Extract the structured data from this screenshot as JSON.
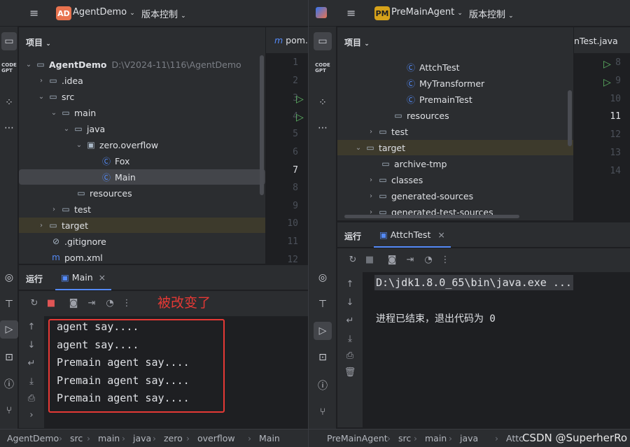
{
  "left": {
    "project_badge": "AD",
    "project_name": "AgentDemo",
    "vcs_menu": "版本控制",
    "project_panel_title": "项目",
    "editor_tab": "pom.",
    "tree": [
      {
        "label": "AgentDemo",
        "path": "D:\\V2024-11\\116\\AgentDemo",
        "icon": "folder",
        "bold": true
      },
      {
        "label": ".idea",
        "icon": "folder"
      },
      {
        "label": "src",
        "icon": "folder"
      },
      {
        "label": "main",
        "icon": "folder"
      },
      {
        "label": "java",
        "icon": "folder"
      },
      {
        "label": "zero.overflow",
        "icon": "package"
      },
      {
        "label": "Fox",
        "icon": "class"
      },
      {
        "label": "Main",
        "icon": "class",
        "selected": true
      },
      {
        "label": "resources",
        "icon": "folder"
      },
      {
        "label": "test",
        "icon": "folder"
      },
      {
        "label": "target",
        "icon": "folder",
        "highlighted": true
      },
      {
        "label": ".gitignore",
        "icon": "ignore"
      },
      {
        "label": "pom.xml",
        "icon": "maven"
      }
    ],
    "line_numbers": [
      "1",
      "2",
      "3",
      "4",
      "5",
      "6",
      "7",
      "8",
      "9",
      "10",
      "11",
      "12"
    ],
    "run_label": "运行",
    "run_tab": "Main",
    "annotation": "被改变了",
    "console_lines": [
      "agent say....",
      "agent say....",
      "Premain agent say....",
      "Premain agent say....",
      "Premain agent say...."
    ],
    "breadcrumb": [
      "AgentDemo",
      "src",
      "main",
      "java",
      "zero",
      "overflow",
      "Main"
    ]
  },
  "right": {
    "project_badge": "PM",
    "project_name": "PreMainAgent",
    "vcs_menu": "版本控制",
    "project_panel_title": "项目",
    "editor_tab": "nTest.java",
    "tree": [
      {
        "label": "AttchTest",
        "icon": "class"
      },
      {
        "label": "MyTransformer",
        "icon": "class"
      },
      {
        "label": "PremainTest",
        "icon": "class"
      },
      {
        "label": "resources",
        "icon": "folder"
      },
      {
        "label": "test",
        "icon": "folder"
      },
      {
        "label": "target",
        "icon": "folder",
        "highlighted": true
      },
      {
        "label": "archive-tmp",
        "icon": "folder"
      },
      {
        "label": "classes",
        "icon": "folder"
      },
      {
        "label": "generated-sources",
        "icon": "folder"
      },
      {
        "label": "generated-test-sources",
        "icon": "folder"
      }
    ],
    "line_numbers": [
      "8",
      "9",
      "10",
      "11",
      "12",
      "13",
      "14"
    ],
    "run_label": "运行",
    "run_tab": "AttchTest",
    "console_cmd": "D:\\jdk1.8.0_65\\bin\\java.exe ...",
    "console_exit": "进程已结束，退出代码为 0",
    "breadcrumb": [
      "PreMainAgent",
      "src",
      "main",
      "java",
      "Attc"
    ],
    "watermark": "CSDN @SuperherRo"
  },
  "colors": {
    "annotation_red": "#e53935",
    "accent_blue": "#548af7",
    "run_green": "#5fb865",
    "badge_ad": "#e8734f",
    "badge_pm": "#d6a21a"
  }
}
